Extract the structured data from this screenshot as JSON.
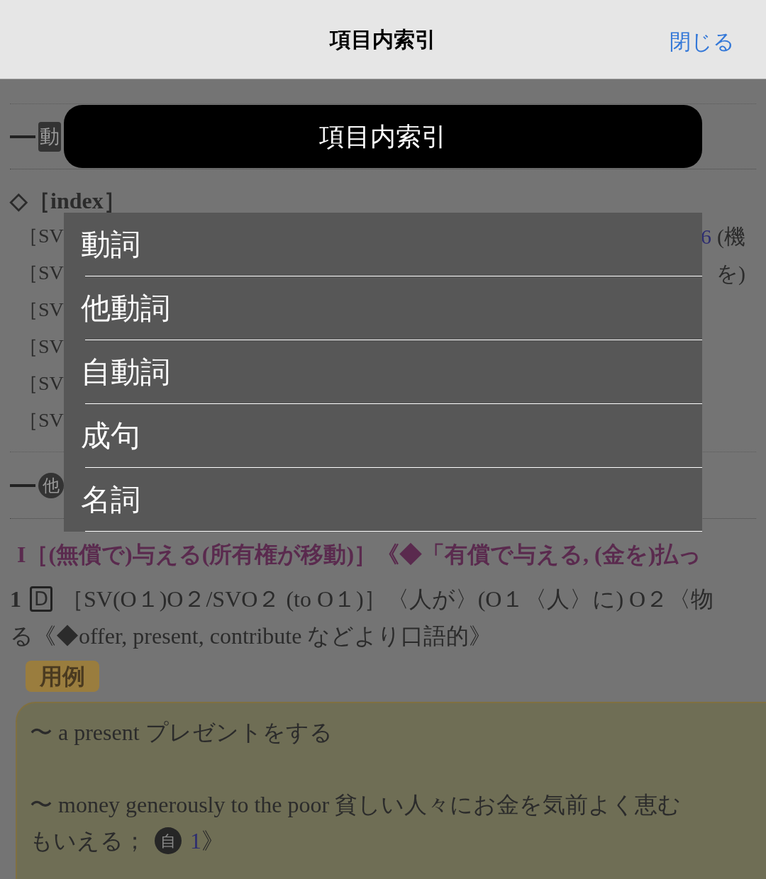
{
  "header": {
    "title": "項目内索引",
    "close": "閉じる"
  },
  "entry": {
    "verb_badge": "動",
    "index_heading": "◇［index］",
    "pattern_lines": [
      {
        "text": "［SV",
        "link": "6",
        "tail": "(機"
      },
      {
        "text": "［SV",
        "tail": "を)"
      },
      {
        "text": "［SV"
      },
      {
        "text": "［SV"
      },
      {
        "text": "［SV"
      },
      {
        "text": "［SV"
      }
    ],
    "transitive_badge": "他",
    "sense_heading": "I［(無償で)与える(所有権が移動)］《◆「有償で与える, (金を)払っ",
    "sense_number": "1",
    "sense_label": "D",
    "sense_pattern": "［SV(O１)O２/SVO２ (to O１)］〈人が〉(O１〈人〉に) O２〈物",
    "sense_note": "る《◆offer, present, contribute などより口語的》",
    "examples_label": "用例",
    "examples": [
      "〜 a present プレゼントをする",
      "〜 money generously to the poor 貧しい人々にお金を気前よく恵む"
    ],
    "example_tail": {
      "text": "もいえる；",
      "badge": "自",
      "link": "1",
      "close": "》"
    }
  },
  "popup": {
    "title": "項目内索引",
    "items": [
      "動詞",
      "他動詞",
      "自動詞",
      "成句",
      "名詞"
    ]
  }
}
